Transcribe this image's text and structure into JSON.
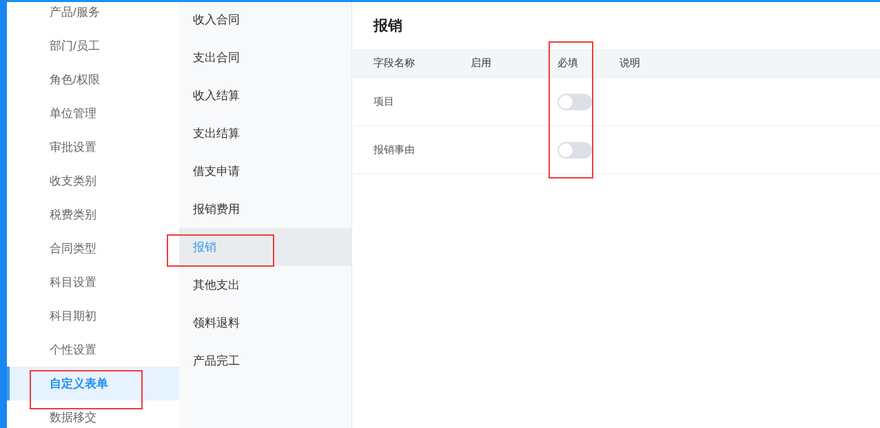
{
  "sidebar": {
    "items": [
      {
        "label": "产品/服务",
        "selected": false
      },
      {
        "label": "部门/员工",
        "selected": false
      },
      {
        "label": "角色/权限",
        "selected": false
      },
      {
        "label": "单位管理",
        "selected": false
      },
      {
        "label": "审批设置",
        "selected": false
      },
      {
        "label": "收支类别",
        "selected": false
      },
      {
        "label": "税费类别",
        "selected": false
      },
      {
        "label": "合同类型",
        "selected": false
      },
      {
        "label": "科目设置",
        "selected": false
      },
      {
        "label": "科目期初",
        "selected": false
      },
      {
        "label": "个性设置",
        "selected": false
      },
      {
        "label": "自定义表单",
        "selected": true
      },
      {
        "label": "数据移交",
        "selected": false
      }
    ]
  },
  "form_list": {
    "items": [
      {
        "label": "收入合同",
        "selected": false
      },
      {
        "label": "支出合同",
        "selected": false
      },
      {
        "label": "收入结算",
        "selected": false
      },
      {
        "label": "支出结算",
        "selected": false
      },
      {
        "label": "借支申请",
        "selected": false
      },
      {
        "label": "报销费用",
        "selected": false
      },
      {
        "label": "报销",
        "selected": true
      },
      {
        "label": "其他支出",
        "selected": false
      },
      {
        "label": "领料退料",
        "selected": false
      },
      {
        "label": "产品完工",
        "selected": false
      }
    ]
  },
  "panel": {
    "title": "报销",
    "table": {
      "columns": [
        "字段名称",
        "启用",
        "必填",
        "说明"
      ],
      "rows": [
        {
          "name": "项目",
          "required": false
        },
        {
          "name": "报销事由",
          "required": false
        }
      ]
    }
  }
}
